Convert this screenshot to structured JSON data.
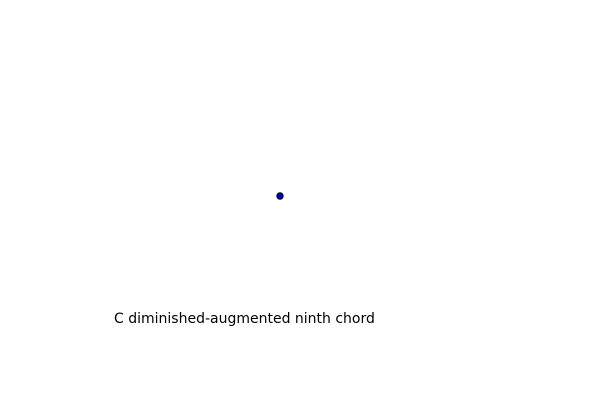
{
  "caption": "C diminished-augmented ninth chord",
  "colors": {
    "background": "#ffffff",
    "dot_fill": "#0000aa",
    "dot_stroke": "#000033",
    "text": "#000000"
  }
}
